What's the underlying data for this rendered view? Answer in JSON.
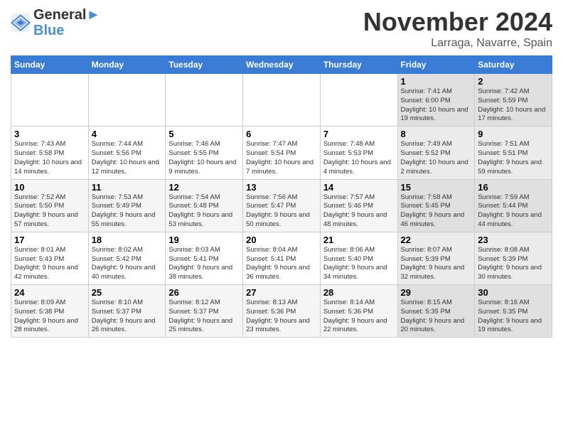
{
  "header": {
    "logo_line1": "General",
    "logo_line2": "Blue",
    "month": "November 2024",
    "location": "Larraga, Navarre, Spain"
  },
  "weekdays": [
    "Sunday",
    "Monday",
    "Tuesday",
    "Wednesday",
    "Thursday",
    "Friday",
    "Saturday"
  ],
  "weeks": [
    [
      {
        "day": "",
        "info": ""
      },
      {
        "day": "",
        "info": ""
      },
      {
        "day": "",
        "info": ""
      },
      {
        "day": "",
        "info": ""
      },
      {
        "day": "",
        "info": ""
      },
      {
        "day": "1",
        "info": "Sunrise: 7:41 AM\nSunset: 6:00 PM\nDaylight: 10 hours and 19 minutes."
      },
      {
        "day": "2",
        "info": "Sunrise: 7:42 AM\nSunset: 5:59 PM\nDaylight: 10 hours and 17 minutes."
      }
    ],
    [
      {
        "day": "3",
        "info": "Sunrise: 7:43 AM\nSunset: 5:58 PM\nDaylight: 10 hours and 14 minutes."
      },
      {
        "day": "4",
        "info": "Sunrise: 7:44 AM\nSunset: 5:56 PM\nDaylight: 10 hours and 12 minutes."
      },
      {
        "day": "5",
        "info": "Sunrise: 7:46 AM\nSunset: 5:55 PM\nDaylight: 10 hours and 9 minutes."
      },
      {
        "day": "6",
        "info": "Sunrise: 7:47 AM\nSunset: 5:54 PM\nDaylight: 10 hours and 7 minutes."
      },
      {
        "day": "7",
        "info": "Sunrise: 7:48 AM\nSunset: 5:53 PM\nDaylight: 10 hours and 4 minutes."
      },
      {
        "day": "8",
        "info": "Sunrise: 7:49 AM\nSunset: 5:52 PM\nDaylight: 10 hours and 2 minutes."
      },
      {
        "day": "9",
        "info": "Sunrise: 7:51 AM\nSunset: 5:51 PM\nDaylight: 9 hours and 59 minutes."
      }
    ],
    [
      {
        "day": "10",
        "info": "Sunrise: 7:52 AM\nSunset: 5:50 PM\nDaylight: 9 hours and 57 minutes."
      },
      {
        "day": "11",
        "info": "Sunrise: 7:53 AM\nSunset: 5:49 PM\nDaylight: 9 hours and 55 minutes."
      },
      {
        "day": "12",
        "info": "Sunrise: 7:54 AM\nSunset: 5:48 PM\nDaylight: 9 hours and 53 minutes."
      },
      {
        "day": "13",
        "info": "Sunrise: 7:56 AM\nSunset: 5:47 PM\nDaylight: 9 hours and 50 minutes."
      },
      {
        "day": "14",
        "info": "Sunrise: 7:57 AM\nSunset: 5:46 PM\nDaylight: 9 hours and 48 minutes."
      },
      {
        "day": "15",
        "info": "Sunrise: 7:58 AM\nSunset: 5:45 PM\nDaylight: 9 hours and 46 minutes."
      },
      {
        "day": "16",
        "info": "Sunrise: 7:59 AM\nSunset: 5:44 PM\nDaylight: 9 hours and 44 minutes."
      }
    ],
    [
      {
        "day": "17",
        "info": "Sunrise: 8:01 AM\nSunset: 5:43 PM\nDaylight: 9 hours and 42 minutes."
      },
      {
        "day": "18",
        "info": "Sunrise: 8:02 AM\nSunset: 5:42 PM\nDaylight: 9 hours and 40 minutes."
      },
      {
        "day": "19",
        "info": "Sunrise: 8:03 AM\nSunset: 5:41 PM\nDaylight: 9 hours and 38 minutes."
      },
      {
        "day": "20",
        "info": "Sunrise: 8:04 AM\nSunset: 5:41 PM\nDaylight: 9 hours and 36 minutes."
      },
      {
        "day": "21",
        "info": "Sunrise: 8:06 AM\nSunset: 5:40 PM\nDaylight: 9 hours and 34 minutes."
      },
      {
        "day": "22",
        "info": "Sunrise: 8:07 AM\nSunset: 5:39 PM\nDaylight: 9 hours and 32 minutes."
      },
      {
        "day": "23",
        "info": "Sunrise: 8:08 AM\nSunset: 5:39 PM\nDaylight: 9 hours and 30 minutes."
      }
    ],
    [
      {
        "day": "24",
        "info": "Sunrise: 8:09 AM\nSunset: 5:38 PM\nDaylight: 9 hours and 28 minutes."
      },
      {
        "day": "25",
        "info": "Sunrise: 8:10 AM\nSunset: 5:37 PM\nDaylight: 9 hours and 26 minutes."
      },
      {
        "day": "26",
        "info": "Sunrise: 8:12 AM\nSunset: 5:37 PM\nDaylight: 9 hours and 25 minutes."
      },
      {
        "day": "27",
        "info": "Sunrise: 8:13 AM\nSunset: 5:36 PM\nDaylight: 9 hours and 23 minutes."
      },
      {
        "day": "28",
        "info": "Sunrise: 8:14 AM\nSunset: 5:36 PM\nDaylight: 9 hours and 22 minutes."
      },
      {
        "day": "29",
        "info": "Sunrise: 8:15 AM\nSunset: 5:35 PM\nDaylight: 9 hours and 20 minutes."
      },
      {
        "day": "30",
        "info": "Sunrise: 8:16 AM\nSunset: 5:35 PM\nDaylight: 9 hours and 19 minutes."
      }
    ]
  ]
}
